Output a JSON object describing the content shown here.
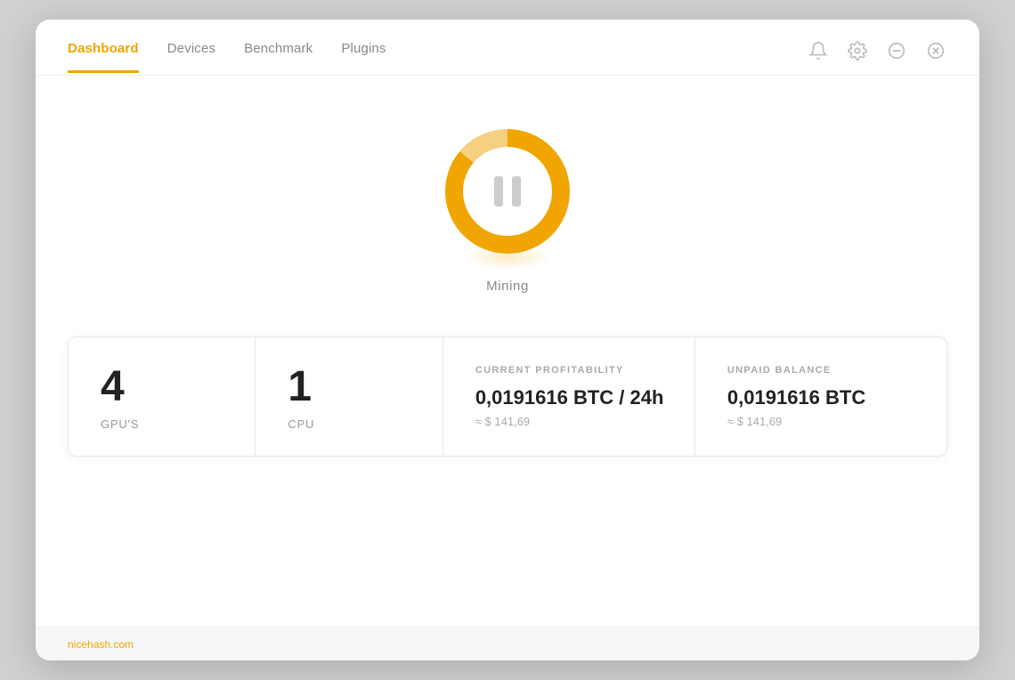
{
  "nav": {
    "items": [
      {
        "id": "dashboard",
        "label": "Dashboard",
        "active": true
      },
      {
        "id": "devices",
        "label": "Devices",
        "active": false
      },
      {
        "id": "benchmark",
        "label": "Benchmark",
        "active": false
      },
      {
        "id": "plugins",
        "label": "Plugins",
        "active": false
      }
    ],
    "icons": {
      "bell": "bell-icon",
      "settings": "gear-icon",
      "minimize": "minimize-icon",
      "close": "close-icon"
    }
  },
  "mining": {
    "state_label": "Mining",
    "button_action": "pause"
  },
  "stats": {
    "gpu_count": "4",
    "gpu_label": "GPU'S",
    "cpu_count": "1",
    "cpu_label": "CPU",
    "profitability": {
      "title": "CURRENT PROFITABILITY",
      "btc_value": "0,0191616",
      "btc_unit": "BTC / 24h",
      "usd_approx": "≈ $ 141,69"
    },
    "balance": {
      "title": "UNPAID BALANCE",
      "btc_value": "0,0191616",
      "btc_unit": "BTC",
      "usd_approx": "≈ $ 141,69"
    }
  },
  "bottom": {
    "link_label": "nicehash.com"
  },
  "colors": {
    "accent": "#f0a500",
    "active_nav": "#f0a500"
  }
}
